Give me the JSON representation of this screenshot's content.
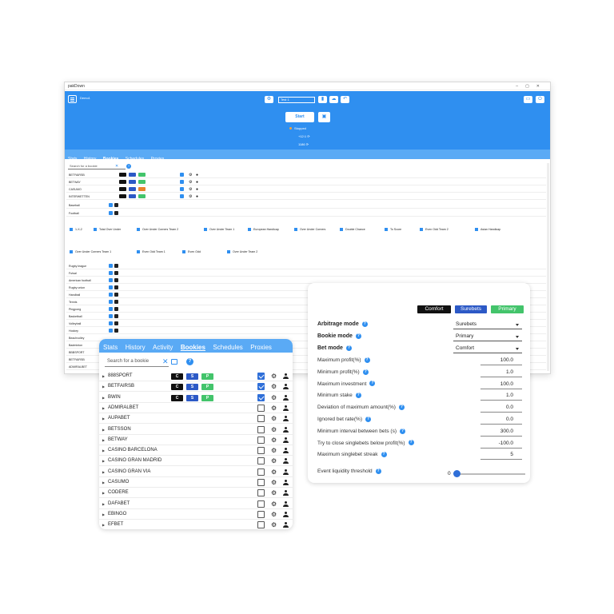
{
  "main_window": {
    "title": "pakDown",
    "user": "Demo1",
    "account_input": "Test 1",
    "start_label": "Start",
    "status": "Stopped",
    "counter_a": "+12:1",
    "counter_b": "1186",
    "tabs": [
      "Stats",
      "History",
      "Bookies",
      "Schedules",
      "Proxies"
    ],
    "search_placeholder": "Search for a bookie",
    "bookies": [
      {
        "name": "BETFAIRSB"
      },
      {
        "name": "BETWAY"
      },
      {
        "name": "CASUMO"
      },
      {
        "name": "INTERWETTEN"
      }
    ],
    "sports_top": [
      "Baseball",
      "Football"
    ],
    "markets_row1": [
      "1-X-2",
      "Total Over Under",
      "Over Under Corners Team 2",
      "Over Under Team 1",
      "European Handicap",
      "Over Under Corners",
      "Double Chance",
      "To Score",
      "Even Odd Team 2",
      "Asian Handicap"
    ],
    "markets_row2": [
      "Over Under Corners Team 1",
      "Even Odd Team 1",
      "Even Odd",
      "Over Under Team 2"
    ],
    "sports_bottom": [
      "Rugby league",
      "Futsal",
      "American football",
      "Rugby union",
      "Handball",
      "Tennis",
      "Pingpong",
      "Basketball",
      "Volleyball",
      "Hockey",
      "Beachvolley",
      "Badminton",
      "BBBSPORT",
      "BETFAIRSB",
      "ADMIRALBET"
    ]
  },
  "bookies_panel": {
    "tabs": [
      "Stats",
      "History",
      "Activity",
      "Bookies",
      "Schedules",
      "Proxies"
    ],
    "active_tab": "Bookies",
    "search_placeholder": "Search for a bookie",
    "tag_labels": {
      "c": "C",
      "s": "S",
      "p": "P"
    },
    "rows": [
      {
        "name": "888SPORT",
        "tags": true,
        "checked": true
      },
      {
        "name": "BETFAIRSB",
        "tags": true,
        "checked": true
      },
      {
        "name": "BWIN",
        "tags": true,
        "checked": true
      },
      {
        "name": "ADMIRALBET",
        "tags": false,
        "checked": false
      },
      {
        "name": "AUPABET",
        "tags": false,
        "checked": false
      },
      {
        "name": "BETSSON",
        "tags": false,
        "checked": false
      },
      {
        "name": "BETWAY",
        "tags": false,
        "checked": false
      },
      {
        "name": "CASINO BARCELONA",
        "tags": false,
        "checked": false
      },
      {
        "name": "CASINO GRAN MADRID",
        "tags": false,
        "checked": false
      },
      {
        "name": "CASINO GRAN VIA",
        "tags": false,
        "checked": false
      },
      {
        "name": "CASUMO",
        "tags": false,
        "checked": false
      },
      {
        "name": "CODERE",
        "tags": false,
        "checked": false
      },
      {
        "name": "DAFABET",
        "tags": false,
        "checked": false
      },
      {
        "name": "EBINGO",
        "tags": false,
        "checked": false
      },
      {
        "name": "EFBET",
        "tags": false,
        "checked": false
      }
    ]
  },
  "settings_panel": {
    "chips": {
      "comfort": "Comfort",
      "surebets": "Surebets",
      "primary": "Primary"
    },
    "selects": [
      {
        "label": "Arbitrage mode",
        "value": "Surebets"
      },
      {
        "label": "Bookie mode",
        "value": "Primary"
      },
      {
        "label": "Bet mode",
        "value": "Comfort"
      }
    ],
    "fields": [
      {
        "label": "Maximum profit(%)",
        "value": "100.0"
      },
      {
        "label": "Minimum profit(%)",
        "value": "1.0"
      },
      {
        "label": "Maximum investment",
        "value": "100.0"
      },
      {
        "label": "Minimum stake",
        "value": "1.0"
      },
      {
        "label": "Deviation of maximum amount(%)",
        "value": "0.0"
      },
      {
        "label": "Ignored bet rate(%)",
        "value": "0.0"
      },
      {
        "label": "Minimum interval between bets (s)",
        "value": "300.0"
      },
      {
        "label": "Try to close singlebets below profit(%)",
        "value": "-100.0"
      },
      {
        "label": "Maximum singlebet streak",
        "value": "5"
      }
    ],
    "liquidity_label": "Event liquidity threshold",
    "liquidity_value": "0"
  },
  "colors": {
    "accent": "#2f8ff0",
    "tab_bar": "#5aaaf5",
    "comfort": "#111111",
    "surebets": "#2c59c6",
    "primary": "#43c46b"
  },
  "icons": [
    "menu-icon",
    "gear-icon",
    "person-icon",
    "help-icon",
    "close-icon",
    "filter-icon",
    "save-icon",
    "refresh-icon",
    "caret-right-icon",
    "chevron-down-icon"
  ]
}
